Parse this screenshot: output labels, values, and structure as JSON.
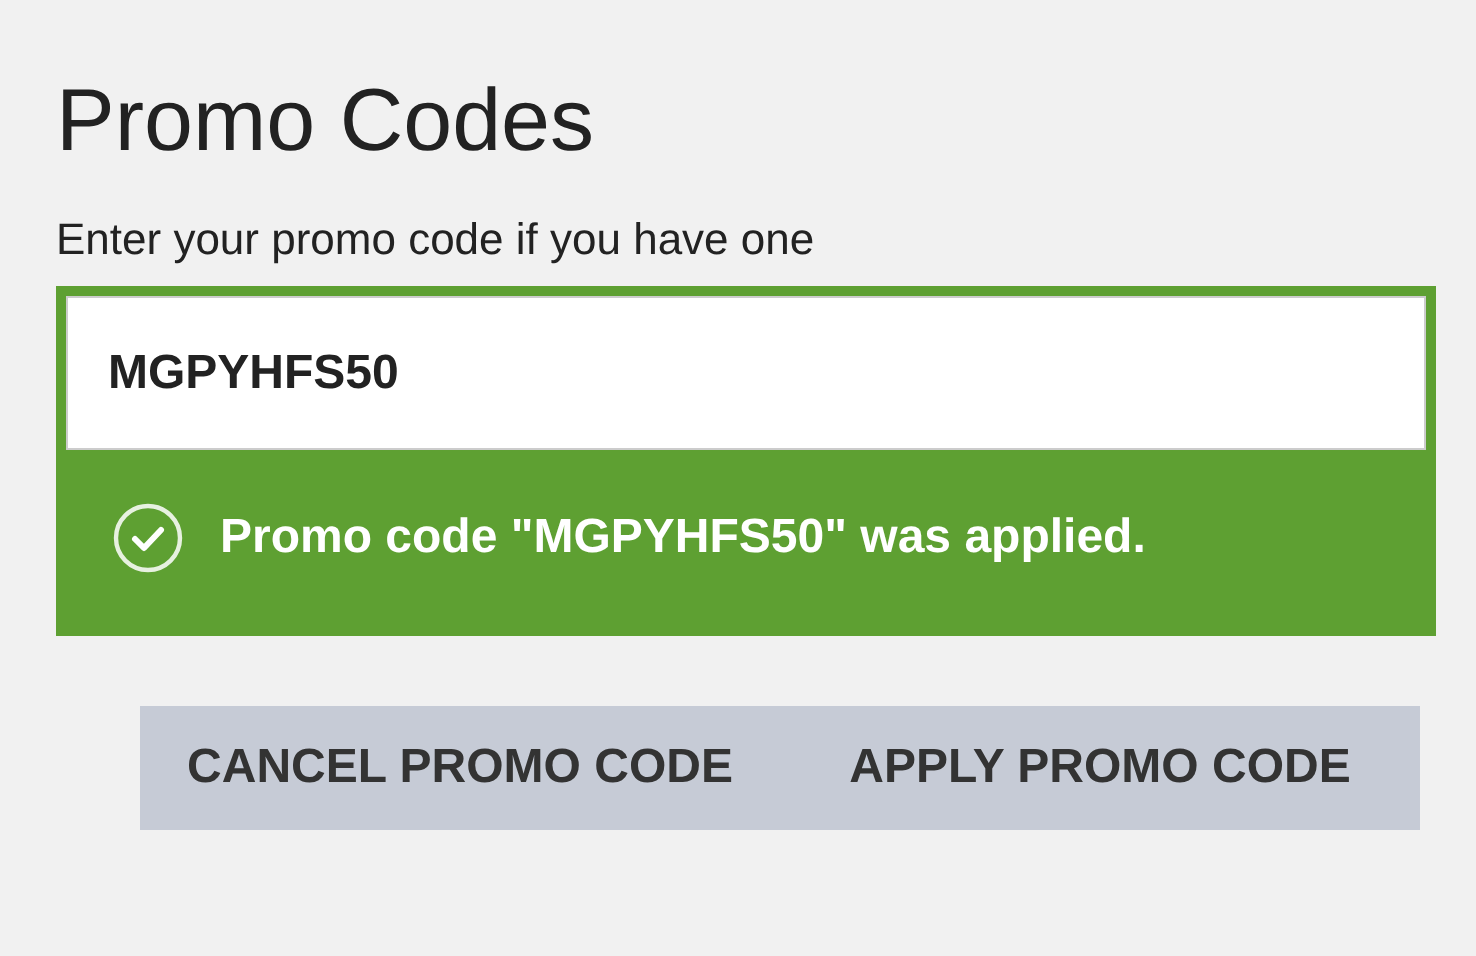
{
  "title": "Promo Codes",
  "prompt": "Enter your promo code if you have one",
  "promo_field": {
    "value": "MGPYHFS50"
  },
  "message": {
    "text": "Promo code \"MGPYHFS50\" was applied.",
    "applied": true
  },
  "buttons": [
    "CANCEL PROMO CODE",
    "APPLY PROMO CODE"
  ]
}
